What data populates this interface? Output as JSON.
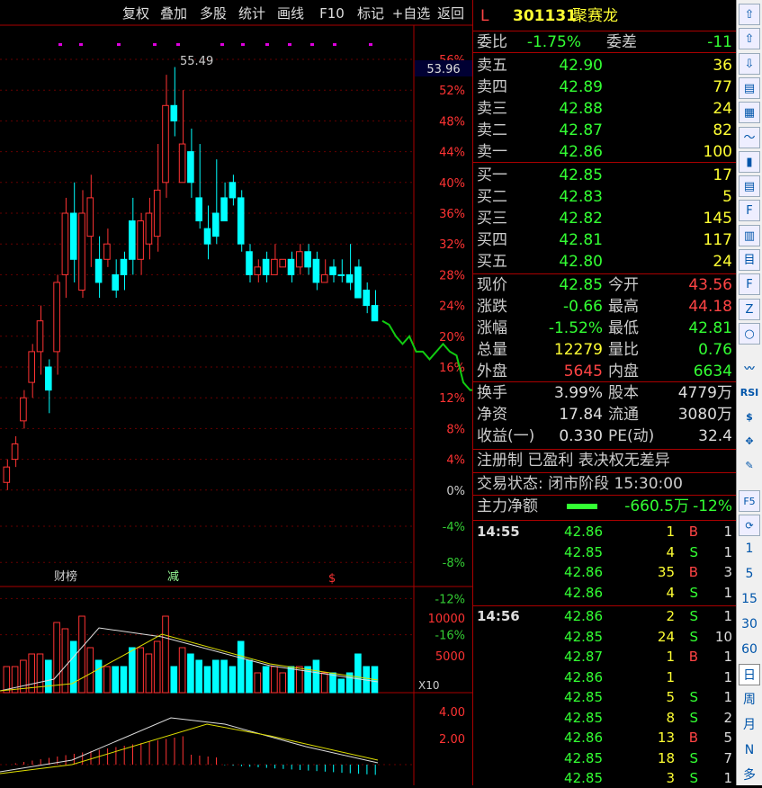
{
  "toolbar": [
    "复权",
    "叠加",
    "多股",
    "统计",
    "画线",
    "F10",
    "标记",
    "+自选",
    "返回"
  ],
  "chart_data": {
    "type": "candlestick",
    "y_ticks": [
      "56%",
      "52%",
      "48%",
      "44%",
      "40%",
      "36%",
      "32%",
      "28%",
      "24%",
      "20%",
      "16%",
      "12%",
      "8%",
      "4%",
      "0%",
      "-4%",
      "-8%",
      "-12%",
      "-16%"
    ],
    "high_label": "55.49",
    "current_label": "53.96",
    "events": [
      "财榜",
      "减",
      "$"
    ],
    "volume_ticks": [
      "10000",
      "5000"
    ],
    "volume_unit": "X10",
    "macd_ticks": [
      "4.00",
      "2.00"
    ],
    "candles": [
      [
        1,
        3,
        0,
        4,
        "u"
      ],
      [
        4,
        6,
        3,
        7,
        "u"
      ],
      [
        9,
        12,
        8,
        13,
        "u"
      ],
      [
        14,
        18,
        12,
        19,
        "u"
      ],
      [
        18,
        22,
        15,
        24,
        "u"
      ],
      [
        13,
        16,
        10,
        17,
        "d"
      ],
      [
        18,
        27,
        15,
        28,
        "u"
      ],
      [
        28,
        36,
        25,
        38,
        "u"
      ],
      [
        36,
        30,
        27,
        40,
        "d"
      ],
      [
        26,
        36,
        25,
        39,
        "u"
      ],
      [
        33,
        38,
        29,
        41,
        "u"
      ],
      [
        30,
        27,
        25,
        33,
        "d"
      ],
      [
        30,
        32,
        29,
        34,
        "u"
      ],
      [
        28,
        26,
        25,
        30,
        "d"
      ],
      [
        30,
        28,
        26,
        31,
        "d"
      ],
      [
        35,
        30,
        28,
        38,
        "d"
      ],
      [
        30,
        35,
        28,
        36,
        "u"
      ],
      [
        32,
        36,
        30,
        38,
        "u"
      ],
      [
        33,
        39,
        31,
        45,
        "u"
      ],
      [
        40,
        50,
        38,
        54,
        "u"
      ],
      [
        50,
        48,
        46,
        55,
        "d"
      ],
      [
        40,
        45,
        40,
        52,
        "u"
      ],
      [
        44,
        40,
        38,
        47,
        "d"
      ],
      [
        38,
        35,
        34,
        45,
        "d"
      ],
      [
        34,
        32,
        30,
        37,
        "d"
      ],
      [
        36,
        33,
        32,
        43,
        "d"
      ],
      [
        38,
        35,
        35,
        40,
        "d"
      ],
      [
        40,
        38,
        37,
        41,
        "d"
      ],
      [
        38,
        32,
        31,
        39,
        "d"
      ],
      [
        31,
        28,
        27,
        32,
        "d"
      ],
      [
        28,
        29,
        27,
        30,
        "u"
      ],
      [
        30,
        28,
        27,
        31,
        "d"
      ],
      [
        28,
        30,
        28,
        32,
        "u"
      ],
      [
        29,
        30,
        29,
        30,
        "u"
      ],
      [
        30,
        28,
        27,
        31,
        "d"
      ],
      [
        29,
        31,
        28,
        32,
        "u"
      ],
      [
        31,
        29,
        28,
        32,
        "d"
      ],
      [
        30,
        27,
        26,
        31,
        "d"
      ],
      [
        27,
        28,
        27,
        30,
        "u"
      ],
      [
        29,
        28,
        27,
        30,
        "d"
      ],
      [
        28,
        28,
        27,
        30,
        "d"
      ],
      [
        28,
        27,
        26,
        32,
        "d"
      ],
      [
        29,
        25,
        25,
        30,
        "d"
      ],
      [
        26,
        24,
        23,
        27,
        "d"
      ],
      [
        24,
        22,
        22,
        26,
        "d"
      ]
    ],
    "intraday": [
      [
        0,
        22
      ],
      [
        1,
        21.5
      ],
      [
        2,
        20
      ],
      [
        3,
        19
      ],
      [
        4,
        20
      ],
      [
        5,
        18
      ],
      [
        6,
        18
      ],
      [
        7,
        17
      ],
      [
        8,
        18
      ],
      [
        9,
        19
      ],
      [
        10,
        18
      ],
      [
        11,
        17.5
      ],
      [
        12,
        14
      ],
      [
        13,
        13
      ],
      [
        14,
        13
      ],
      [
        15,
        14
      ],
      [
        16,
        14
      ],
      [
        17,
        13
      ],
      [
        18,
        12
      ],
      [
        19,
        11
      ],
      [
        20,
        8
      ]
    ]
  },
  "panel": {
    "code": "301131",
    "name": "聚赛龙",
    "wb_label": "委比",
    "wb": "-1.75%",
    "wc_label": "委差",
    "wc": "-11",
    "asks": [
      {
        "l": "卖五",
        "p": "42.90",
        "v": "36"
      },
      {
        "l": "卖四",
        "p": "42.89",
        "v": "77"
      },
      {
        "l": "卖三",
        "p": "42.88",
        "v": "24"
      },
      {
        "l": "卖二",
        "p": "42.87",
        "v": "82"
      },
      {
        "l": "卖一",
        "p": "42.86",
        "v": "100"
      }
    ],
    "bids": [
      {
        "l": "买一",
        "p": "42.85",
        "v": "17"
      },
      {
        "l": "买二",
        "p": "42.83",
        "v": "5"
      },
      {
        "l": "买三",
        "p": "42.82",
        "v": "145"
      },
      {
        "l": "买四",
        "p": "42.81",
        "v": "117"
      },
      {
        "l": "买五",
        "p": "42.80",
        "v": "24"
      }
    ],
    "stats": [
      {
        "a": "现价",
        "av": "42.85",
        "b": "今开",
        "bv": "43.56"
      },
      {
        "a": "涨跌",
        "av": "-0.66",
        "b": "最高",
        "bv": "44.18"
      },
      {
        "a": "涨幅",
        "av": "-1.52%",
        "b": "最低",
        "bv": "42.81"
      },
      {
        "a": "总量",
        "av": "12279",
        "b": "量比",
        "bv": "0.76"
      },
      {
        "a": "外盘",
        "av": "5645",
        "b": "内盘",
        "bv": "6634"
      }
    ],
    "info": [
      {
        "a": "换手",
        "av": "3.99%",
        "b": "股本",
        "bv": "4779万"
      },
      {
        "a": "净资",
        "av": "17.84",
        "b": "流通",
        "bv": "3080万"
      },
      {
        "a": "收益(一)",
        "av": "0.330",
        "b": "PE(动)",
        "bv": "32.4"
      }
    ],
    "tags": "注册制 已盈利 表决权无差异",
    "status": "交易状态: 闭市阶段 15:30:00",
    "flow_label": "主力净额",
    "flow": "-660.5万",
    "flow_pct": "-12%",
    "ticks": [
      {
        "t": "14:55",
        "p": "42.86",
        "v": "1",
        "d": "B",
        "n": "1"
      },
      {
        "t": "",
        "p": "42.85",
        "v": "4",
        "d": "S",
        "n": "1"
      },
      {
        "t": "",
        "p": "42.86",
        "v": "35",
        "d": "B",
        "n": "3"
      },
      {
        "t": "",
        "p": "42.86",
        "v": "4",
        "d": "S",
        "n": "1"
      },
      {
        "t": "14:56",
        "p": "42.86",
        "v": "2",
        "d": "S",
        "n": "1"
      },
      {
        "t": "",
        "p": "42.85",
        "v": "24",
        "d": "S",
        "n": "10"
      },
      {
        "t": "",
        "p": "42.87",
        "v": "1",
        "d": "B",
        "n": "1"
      },
      {
        "t": "",
        "p": "42.86",
        "v": "1",
        "d": "",
        "n": "1"
      },
      {
        "t": "",
        "p": "42.85",
        "v": "5",
        "d": "S",
        "n": "1"
      },
      {
        "t": "",
        "p": "42.85",
        "v": "8",
        "d": "S",
        "n": "2"
      },
      {
        "t": "",
        "p": "42.86",
        "v": "13",
        "d": "B",
        "n": "5"
      },
      {
        "t": "",
        "p": "42.85",
        "v": "18",
        "d": "S",
        "n": "7"
      },
      {
        "t": "",
        "p": "42.85",
        "v": "3",
        "d": "S",
        "n": "1"
      }
    ]
  },
  "side": [
    "1",
    "5",
    "15",
    "30",
    "60",
    "日",
    "周",
    "月",
    "N",
    "多"
  ]
}
